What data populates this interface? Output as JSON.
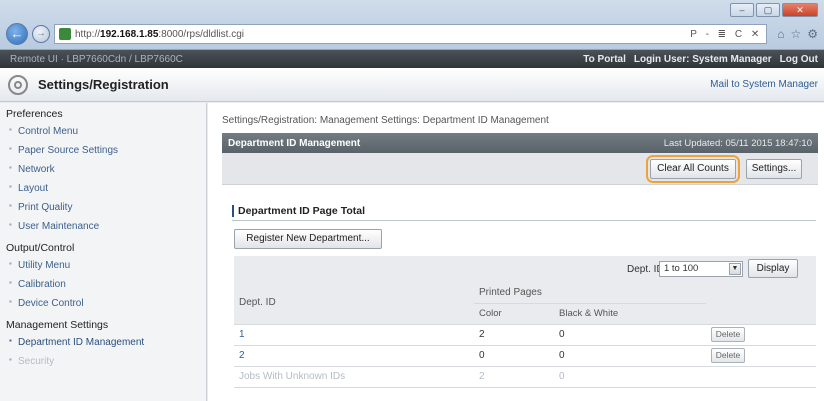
{
  "browser": {
    "url_prefix": "http://",
    "url_host": "192.168.1.85",
    "url_rest": ":8000/rps/dldlist.cgi",
    "address_tools": "P - ≣ C ✕",
    "window_buttons": [
      "–",
      "▢",
      "✕"
    ]
  },
  "topbar": {
    "device_info": "Remote UI  · LBP7660Cdn / LBP7660C",
    "to_portal": "To Portal",
    "login_user": "Login User: System Manager",
    "log_out": "Log Out"
  },
  "header": {
    "title": "Settings/Registration",
    "mail_link": "Mail to System Manager"
  },
  "sidebar": {
    "groups": [
      {
        "label": "Preferences",
        "items": [
          "Control Menu",
          "Paper Source Settings",
          "Network",
          "Layout",
          "Print Quality",
          "User Maintenance"
        ]
      },
      {
        "label": "Output/Control",
        "items": [
          "Utility Menu",
          "Calibration",
          "Device Control"
        ]
      },
      {
        "label": "Management Settings",
        "items": [
          "Department ID Management",
          "Security"
        ]
      }
    ]
  },
  "main": {
    "breadcrumb": "Settings/Registration: Management Settings: Department ID Management",
    "panel_title": "Department ID Management",
    "last_updated": "Last Updated: 05/11 2015 18:47:10",
    "clear_all_counts": "Clear All Counts",
    "settings": "Settings...",
    "section_title": "Department ID Page Total",
    "register_button": "Register New Department...",
    "filter": {
      "label": "Dept. ID:",
      "selected": "1 to 100",
      "display_button": "Display"
    },
    "table": {
      "col_dept": "Dept. ID",
      "col_printed": "Printed Pages",
      "col_color": "Color",
      "col_bw": "Black & White",
      "rows": [
        {
          "id": "1",
          "color": "2",
          "bw": "0",
          "action": "Delete"
        },
        {
          "id": "2",
          "color": "0",
          "bw": "0",
          "action": "Delete"
        },
        {
          "id": "Jobs With Unknown IDs",
          "color": "2",
          "bw": "0",
          "action": ""
        }
      ]
    }
  },
  "colors": {
    "highlight": "#f0a23a",
    "panel_header": "#5f676e",
    "link": "#2d5d96"
  }
}
